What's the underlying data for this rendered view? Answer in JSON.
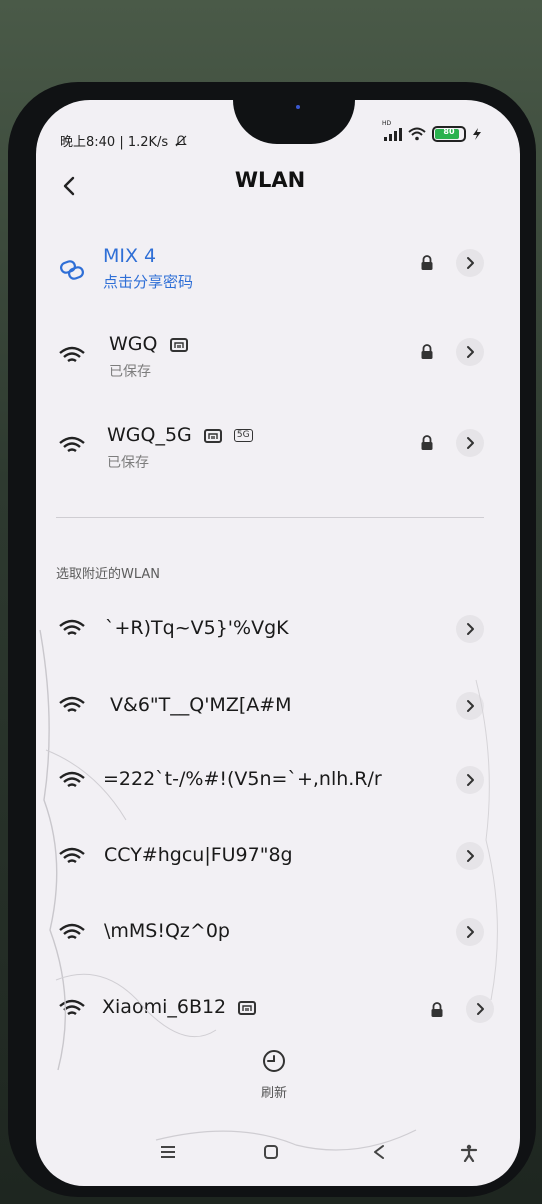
{
  "status_bar": {
    "left_text": "晚上8:40 | 1.2K/s",
    "network_badge": "HD",
    "battery_level": "80"
  },
  "header": {
    "title": "WLAN"
  },
  "saved_networks": [
    {
      "name": "MIX 4",
      "subtitle": "点击分享密码",
      "connected": true,
      "locked": true
    },
    {
      "name": "WGQ",
      "subtitle": "已保存",
      "locked": true
    },
    {
      "name": "WGQ_5G",
      "subtitle": "已保存",
      "band_tag": "5G",
      "locked": true
    }
  ],
  "section_label": "选取附近的WLAN",
  "nearby_networks": [
    {
      "name": "`+R)Tq~V5}'%VgK"
    },
    {
      "name": "V&6\"T__Q'MZ[A#M"
    },
    {
      "name": "=222`t-/%#!(V5n=`+,nlh.R/r"
    },
    {
      "name": "CCY#hgcu|FU97\"8g"
    },
    {
      "name": "\\mMS!Qz^0p"
    },
    {
      "name": "Xiaomi_6B12",
      "locked": true
    }
  ],
  "refresh_label": "刷新",
  "colors": {
    "accent": "#2f6fd6",
    "screen_bg": "#f2f0f4",
    "battery": "#2ab24e"
  },
  "icons": {
    "back": "chevron-left-icon",
    "connected": "link-icon",
    "wifi": "wifi-icon",
    "lock": "lock-icon",
    "chevron": "chevron-right-icon",
    "refresh": "refresh-icon",
    "nav_menu": "menu-icon",
    "nav_home": "home-square-icon",
    "nav_back": "back-triangle-icon",
    "nav_accessibility": "accessibility-icon"
  }
}
